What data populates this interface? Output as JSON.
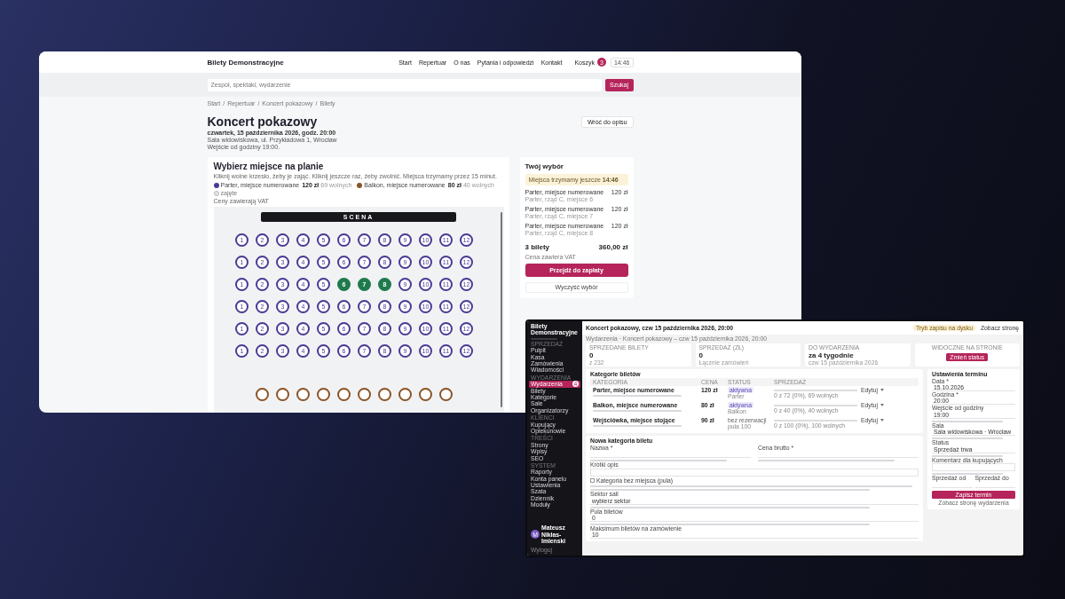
{
  "storefront": {
    "brand": "Bilety Demonstracyjne",
    "nav": [
      {
        "label": "Start"
      },
      {
        "label": "Repertuar"
      },
      {
        "label": "O nas"
      },
      {
        "label": "Pytania i odpowiedzi"
      },
      {
        "label": "Kontakt"
      }
    ],
    "cart": {
      "label": "Koszyk",
      "count": "3",
      "timer": "14:46"
    },
    "search": {
      "placeholder": "Zespół, spektakl, wydarzenie",
      "button": "Szukaj"
    },
    "breadcrumb_separator": "/",
    "breadcrumb": [
      "Start",
      "Repertuar",
      "Koncert pokazowy",
      "Bilety"
    ],
    "event": {
      "title": "Koncert pokazowy",
      "date": "czwartek, 15 października 2026, godz. 20:00",
      "venue": "Sala widowiskowa, ul. Przykładowa 1, Wrocław",
      "entry": "Wejście od godziny 19:00."
    },
    "back_button": "Wróć do opisu",
    "seat_picker": {
      "title": "Wybierz miejsce na planie",
      "instructions": "Kliknij wolne krzesło, żeby je zająć. Kliknij jeszcze raz, żeby zwolnić. Miejsca trzymamy przez 15 minut.",
      "legend": [
        {
          "kind": "category",
          "label": "Parter, miejsce numerowane",
          "price": "120 zł",
          "note": "69 wolnych",
          "color": "#4a3a94"
        },
        {
          "kind": "category",
          "label": "Balkon, miejsce numerowane",
          "price": "80 zł",
          "note": "40 wolnych",
          "color": "#8a5426"
        },
        {
          "kind": "taken",
          "label": "zajęte",
          "color": "#e3e4e8"
        }
      ],
      "vat_note": "Ceny zawierają VAT",
      "stage": "SCENA",
      "rows": [
        {
          "color": "#4a3a94",
          "seats": [
            {
              "label": "1",
              "selected": false
            },
            {
              "label": "2",
              "selected": false
            },
            {
              "label": "3",
              "selected": false
            },
            {
              "label": "4",
              "selected": false
            },
            {
              "label": "5",
              "selected": false
            },
            {
              "label": "6",
              "selected": false
            },
            {
              "label": "7",
              "selected": false
            },
            {
              "label": "8",
              "selected": false
            },
            {
              "label": "9",
              "selected": false
            },
            {
              "label": "10",
              "selected": false
            },
            {
              "label": "11",
              "selected": false
            },
            {
              "label": "12",
              "selected": false
            }
          ]
        },
        {
          "color": "#4a3a94",
          "seats": [
            {
              "label": "1",
              "selected": false
            },
            {
              "label": "2",
              "selected": false
            },
            {
              "label": "3",
              "selected": false
            },
            {
              "label": "4",
              "selected": false
            },
            {
              "label": "5",
              "selected": false
            },
            {
              "label": "6",
              "selected": false
            },
            {
              "label": "7",
              "selected": false
            },
            {
              "label": "8",
              "selected": false
            },
            {
              "label": "9",
              "selected": false
            },
            {
              "label": "10",
              "selected": false
            },
            {
              "label": "11",
              "selected": false
            },
            {
              "label": "12",
              "selected": false
            }
          ]
        },
        {
          "color": "#4a3a94",
          "seats": [
            {
              "label": "1",
              "selected": false
            },
            {
              "label": "2",
              "selected": false
            },
            {
              "label": "3",
              "selected": false
            },
            {
              "label": "4",
              "selected": false
            },
            {
              "label": "5",
              "selected": false
            },
            {
              "label": "6",
              "selected": true
            },
            {
              "label": "7",
              "selected": true
            },
            {
              "label": "8",
              "selected": true
            },
            {
              "label": "9",
              "selected": false
            },
            {
              "label": "10",
              "selected": false
            },
            {
              "label": "11",
              "selected": false
            },
            {
              "label": "12",
              "selected": false
            }
          ]
        },
        {
          "color": "#4a3a94",
          "seats": [
            {
              "label": "1",
              "selected": false
            },
            {
              "label": "2",
              "selected": false
            },
            {
              "label": "3",
              "selected": false
            },
            {
              "label": "4",
              "selected": false
            },
            {
              "label": "5",
              "selected": false
            },
            {
              "label": "6",
              "selected": false
            },
            {
              "label": "7",
              "selected": false
            },
            {
              "label": "8",
              "selected": false
            },
            {
              "label": "9",
              "selected": false
            },
            {
              "label": "10",
              "selected": false
            },
            {
              "label": "11",
              "selected": false
            },
            {
              "label": "12",
              "selected": false
            }
          ]
        },
        {
          "color": "#4a3a94",
          "seats": [
            {
              "label": "1",
              "selected": false
            },
            {
              "label": "2",
              "selected": false
            },
            {
              "label": "3",
              "selected": false
            },
            {
              "label": "4",
              "selected": false
            },
            {
              "label": "5",
              "selected": false
            },
            {
              "label": "6",
              "selected": false
            },
            {
              "label": "7",
              "selected": false
            },
            {
              "label": "8",
              "selected": false
            },
            {
              "label": "9",
              "selected": false
            },
            {
              "label": "10",
              "selected": false
            },
            {
              "label": "11",
              "selected": false
            },
            {
              "label": "12",
              "selected": false
            }
          ]
        },
        {
          "color": "#4a3a94",
          "seats": [
            {
              "label": "1",
              "selected": false
            },
            {
              "label": "2",
              "selected": false
            },
            {
              "label": "3",
              "selected": false
            },
            {
              "label": "4",
              "selected": false
            },
            {
              "label": "5",
              "selected": false
            },
            {
              "label": "6",
              "selected": false
            },
            {
              "label": "7",
              "selected": false
            },
            {
              "label": "8",
              "selected": false
            },
            {
              "label": "9",
              "selected": false
            },
            {
              "label": "10",
              "selected": false
            },
            {
              "label": "11",
              "selected": false
            },
            {
              "label": "12",
              "selected": false
            }
          ]
        },
        {
          "color": "#8a5426",
          "seats": [
            {
              "selected": false
            },
            {
              "selected": false
            },
            {
              "selected": false
            },
            {
              "selected": false
            },
            {
              "selected": false
            },
            {
              "selected": false
            },
            {
              "selected": false
            },
            {
              "selected": false
            },
            {
              "selected": false
            },
            {
              "selected": false
            }
          ]
        }
      ]
    },
    "summary": {
      "title": "Twój wybór",
      "hold_text": "Miejsca trzymamy jeszcze",
      "hold_time": "14:46",
      "items": [
        {
          "name": "Parter, miejsce numerowane",
          "price": "120 zł",
          "detail": "Parter, rząd C, miejsce 6"
        },
        {
          "name": "Parter, miejsce numerowane",
          "price": "120 zł",
          "detail": "Parter, rząd C, miejsce 7"
        },
        {
          "name": "Parter, miejsce numerowane",
          "price": "120 zł",
          "detail": "Parter, rząd C, miejsce 8"
        }
      ],
      "total_label": "3 bilety",
      "total": "360,00 zł",
      "vat_note": "Cena zawiera VAT",
      "checkout": "Przejdź do zapłaty",
      "clear": "Wyczyść wybór"
    }
  },
  "admin": {
    "brand": "Bilety Demonstracyjne",
    "nav_sections": [
      {
        "heading": "SPRZEDAŻ",
        "items": [
          {
            "label": "Pulpit",
            "selected": false
          },
          {
            "label": "Kasa",
            "selected": false
          },
          {
            "label": "Zamówienia",
            "selected": false
          },
          {
            "label": "Wiadomości",
            "selected": false
          }
        ]
      },
      {
        "heading": "WYDARZENIA",
        "items": [
          {
            "label": "Wydarzenia",
            "selected": true,
            "badge": "4"
          },
          {
            "label": "Bilety",
            "selected": false
          },
          {
            "label": "Kategorie",
            "selected": false
          },
          {
            "label": "Sale",
            "selected": false
          },
          {
            "label": "Organizatorzy",
            "selected": false
          }
        ]
      },
      {
        "heading": "KLIENCI",
        "items": [
          {
            "label": "Kupujący",
            "selected": false
          },
          {
            "label": "Opiekunowie",
            "selected": false
          }
        ]
      },
      {
        "heading": "TREŚCI",
        "items": [
          {
            "label": "Strony",
            "selected": false
          },
          {
            "label": "Wpisy",
            "selected": false
          },
          {
            "label": "SEO",
            "selected": false
          }
        ]
      },
      {
        "heading": "SYSTEM",
        "items": [
          {
            "label": "Raporty",
            "selected": false
          },
          {
            "label": "Konta panelu",
            "selected": false
          },
          {
            "label": "Ustawienia",
            "selected": false
          },
          {
            "label": "Szata",
            "selected": false
          },
          {
            "label": "Dziennik",
            "selected": false
          },
          {
            "label": "Moduły",
            "selected": false
          }
        ]
      }
    ],
    "user": {
      "initials": "M",
      "name": "Mateusz Nikłas-Imienski"
    },
    "logout": "Wyloguj",
    "header": {
      "title": "Koncert pokazowy, czw 15 października 2026, 20:00",
      "badge": "Tryb zapisu na dysku",
      "link": "Zobacz stronę"
    },
    "breadcrumb": "Wydarzenia · Koncert pokazowy – czw 15 października 2026, 20:00",
    "stats": [
      {
        "kind": "value",
        "label": "SPRZEDANE BILETY",
        "value": "0",
        "note": "z 232"
      },
      {
        "kind": "value",
        "label": "SPRZEDAŻ (ZŁ)",
        "value": "0",
        "note": "Łącznie zamówień"
      },
      {
        "kind": "value",
        "label": "DO WYDARZENIA",
        "value": "za 4 tygodnie",
        "note": "czw 15 października 2026"
      },
      {
        "kind": "action",
        "label": "WIDOCZNE NA STRONIE",
        "button": "Zmień status"
      }
    ],
    "categories": {
      "title": "Kategorie biletów",
      "columns": [
        "KATEGORIA",
        "CENA",
        "STATUS",
        "SPRZEDAŻ"
      ],
      "rows": [
        {
          "name": "Parter, miejsce numerowane",
          "price": "120 zł",
          "kind": "pill",
          "status": "aktywna",
          "sub": "Parter",
          "level": 0,
          "sold": "0 z 72 (0%), 69 wolnych",
          "action": "Edytuj"
        },
        {
          "name": "Balkon, miejsce numerowane",
          "price": "80 zł",
          "kind": "pill",
          "status": "aktywna",
          "sub": "Balkon",
          "level": 0,
          "sold": "0 z 40 (0%), 40 wolnych",
          "action": "Edytuj"
        },
        {
          "name": "Wejściówka, miejsce stojące",
          "price": "90 zł",
          "kind": "text",
          "status": "bez rezerwacji",
          "sub": "pula 100",
          "level": 0,
          "sold": "0 z 100 (0%), 100 wolnych",
          "action": "Edytuj"
        }
      ]
    },
    "new_category": {
      "title": "Nowa kategoria biletu",
      "name_label": "Nazwa *",
      "price_label": "Cena brutto *",
      "desc_label": "Krótki opis",
      "pool": {
        "label": "Kategoria bez miejsca (pula)",
        "checked": false
      },
      "sector_label": "Sektor sali",
      "sector_value": "wybierz sektor",
      "count_label": "Pula biletów",
      "count_value": "0",
      "max_label": "Maksimum biletów na zamówienie",
      "max_value": "10"
    },
    "term_settings": {
      "title": "Ustawienia terminu",
      "date_label": "Data *",
      "date_value": "15.10.2026",
      "time_label": "Godzina *",
      "time_value": "20:00",
      "entry_label": "Wejście od godziny",
      "entry_value": "19:00",
      "hall_label": "Sala",
      "hall_value": "Sala widowiskowa · Wrocław",
      "status_label": "Status",
      "status_value": "Sprzedaż trwa",
      "comment_label": "Komentarz dla kupujących",
      "from_label": "Sprzedaż od",
      "to_label": "Sprzedaż do",
      "save": "Zapisz termin",
      "view_link": "Zobacz stronę wydarzenia"
    }
  }
}
